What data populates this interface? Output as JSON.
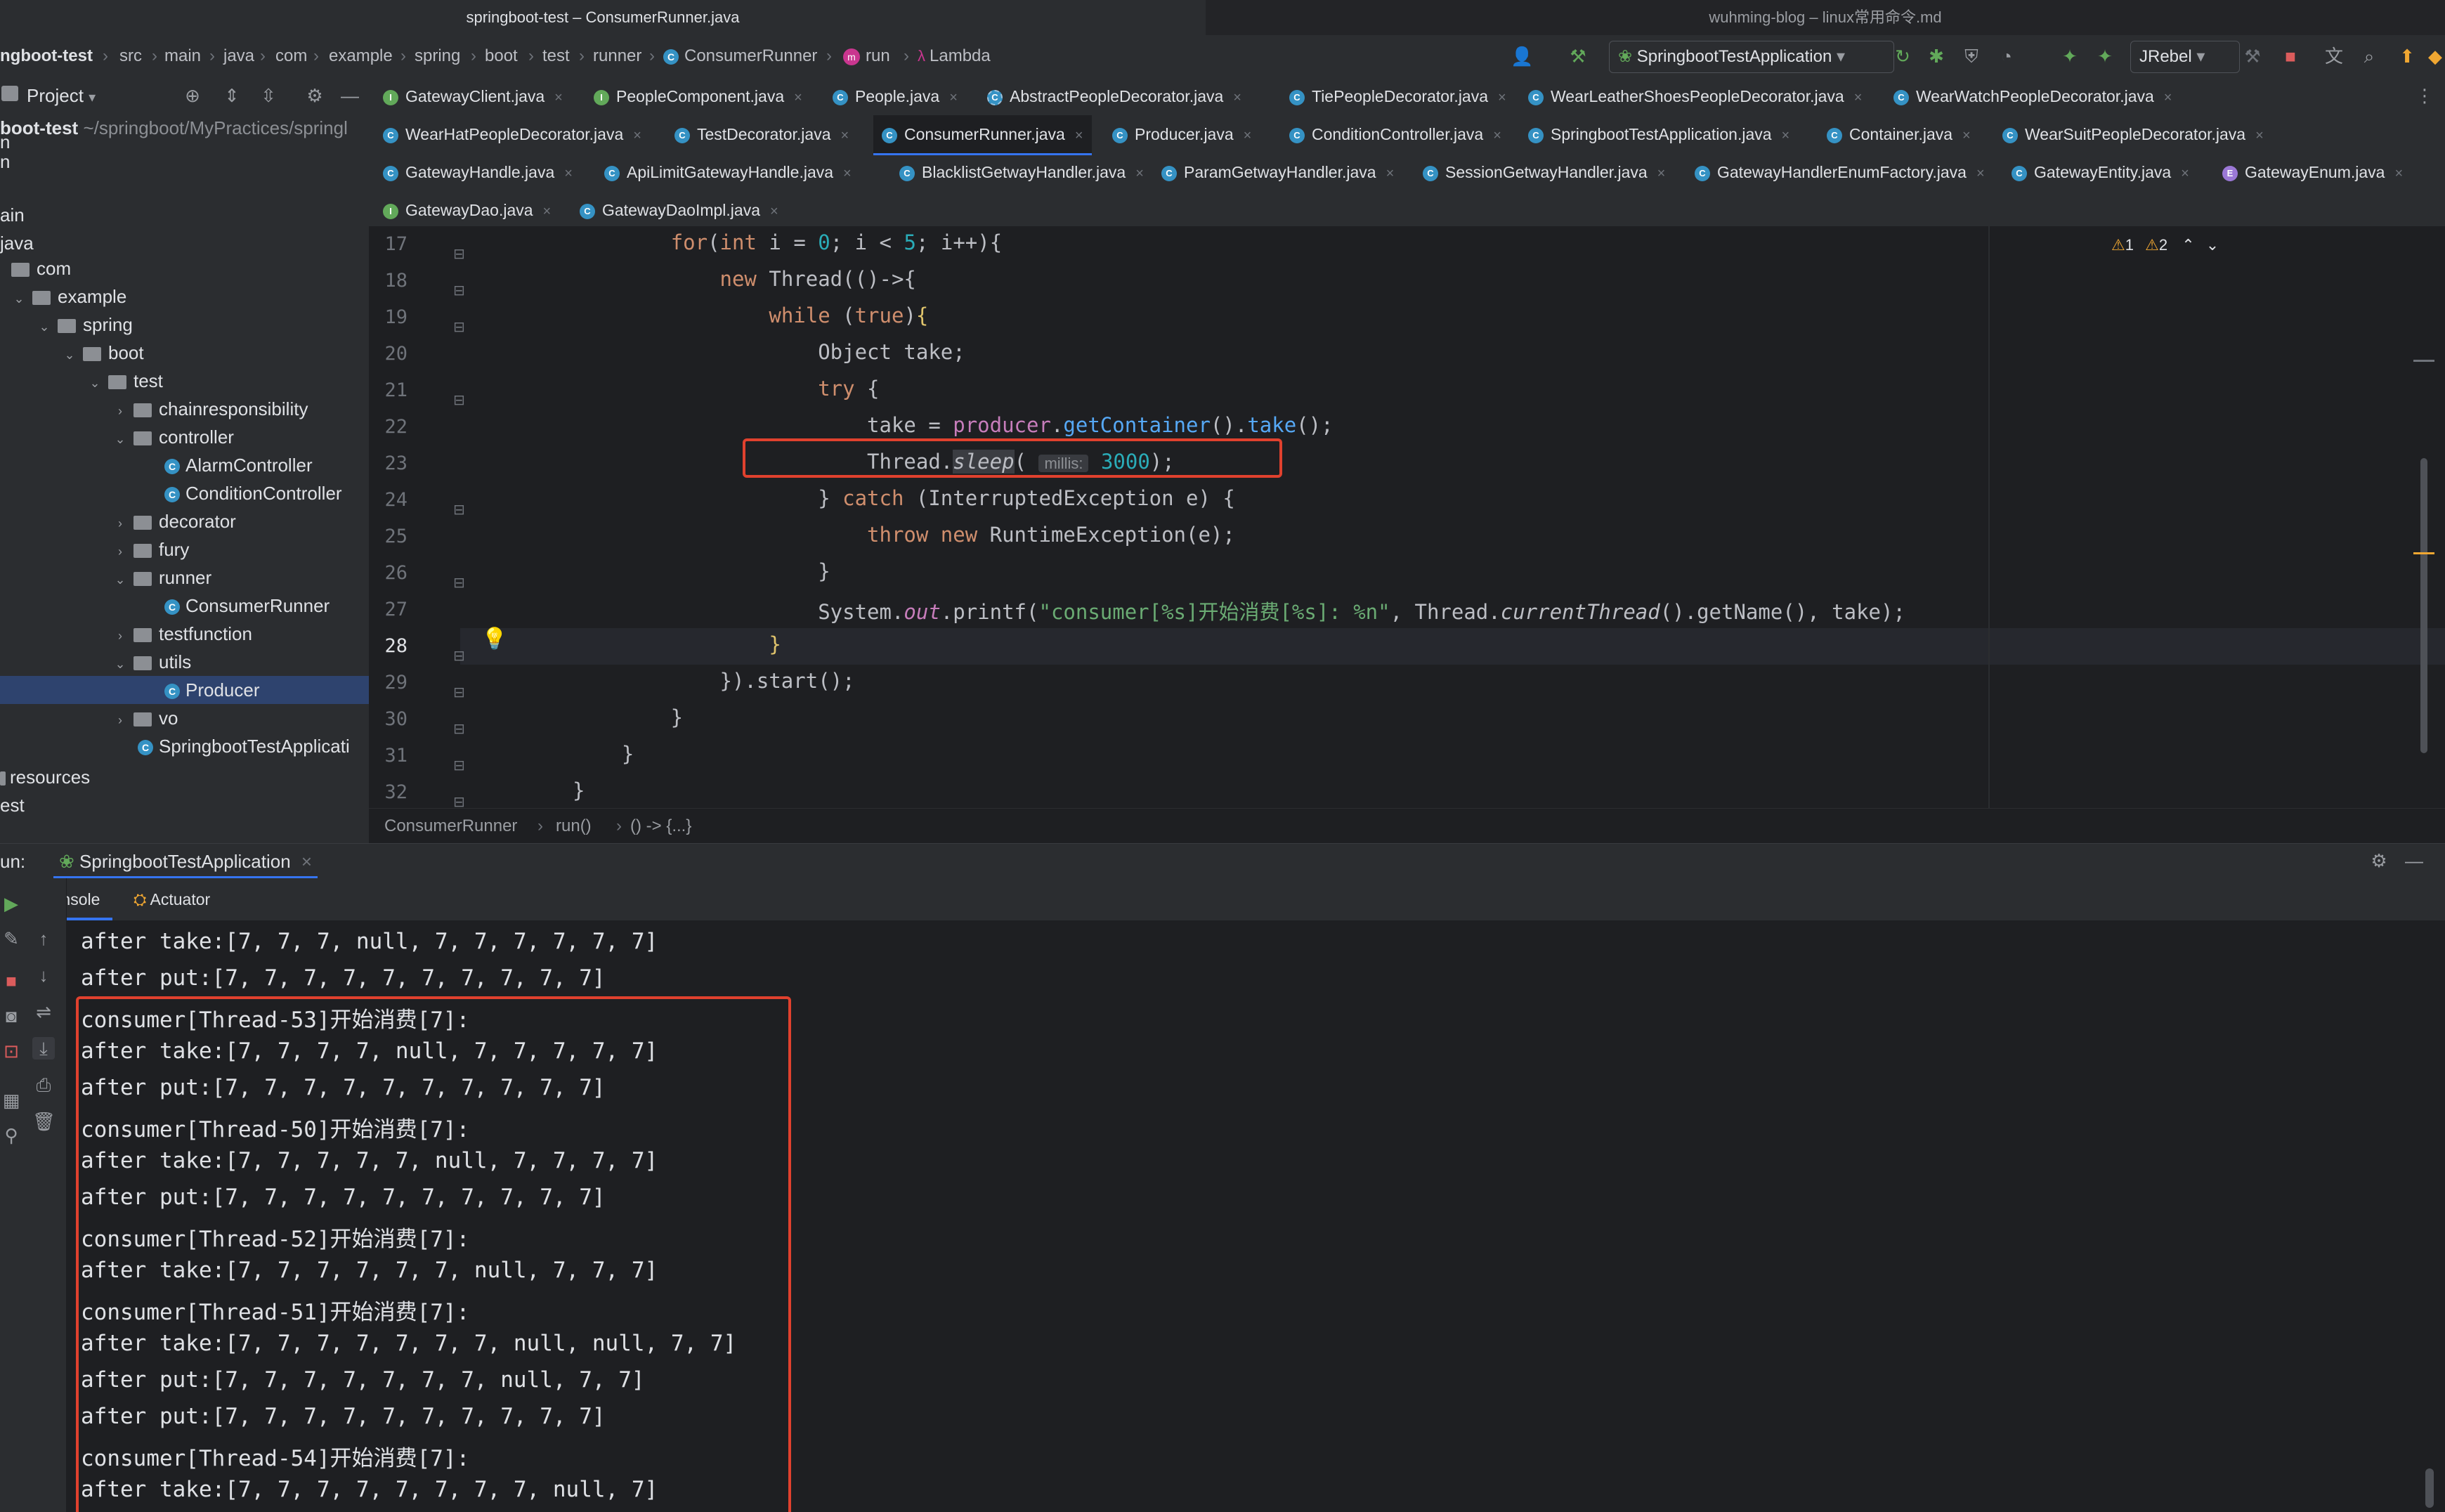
{
  "window": {
    "title_left": "springboot-test – ConsumerRunner.java",
    "title_right": "wuhming-blog – linux常用命令.md"
  },
  "nav": {
    "crumbs": [
      "ngboot-test",
      "src",
      "main",
      "java",
      "com",
      "example",
      "spring",
      "boot",
      "test",
      "runner",
      "ConsumerRunner",
      "run",
      "Lambda"
    ],
    "run_config": "SpringbootTestApplication",
    "jrebel": "JRebel"
  },
  "project": {
    "header": "Project",
    "root_label": "boot-test",
    "root_path": "~/springboot/MyPractices/springl",
    "items": [
      {
        "label": "n",
        "depth": 0
      },
      {
        "label": "n",
        "depth": 0
      },
      {
        "label": "",
        "depth": 0
      },
      {
        "label": "ain",
        "depth": 0
      },
      {
        "label": "java",
        "depth": 0
      },
      {
        "label": "com",
        "depth": 1
      },
      {
        "label": "example",
        "depth": 1
      },
      {
        "label": "spring",
        "depth": 2
      },
      {
        "label": "boot",
        "depth": 3
      },
      {
        "label": "test",
        "depth": 4
      },
      {
        "label": "chainresponsibility",
        "depth": 5
      },
      {
        "label": "controller",
        "depth": 5
      },
      {
        "label": "AlarmController",
        "depth": 6
      },
      {
        "label": "ConditionController",
        "depth": 6
      },
      {
        "label": "decorator",
        "depth": 5
      },
      {
        "label": "fury",
        "depth": 5
      },
      {
        "label": "runner",
        "depth": 5
      },
      {
        "label": "ConsumerRunner",
        "depth": 6
      },
      {
        "label": "testfunction",
        "depth": 5
      },
      {
        "label": "utils",
        "depth": 5
      },
      {
        "label": "Producer",
        "depth": 6
      },
      {
        "label": "vo",
        "depth": 5
      },
      {
        "label": "SpringbootTestApplicati",
        "depth": 5
      },
      {
        "label": "resources",
        "depth": 0
      },
      {
        "label": "est",
        "depth": 0
      }
    ]
  },
  "tabs": {
    "row1": [
      "GatewayClient.java",
      "PeopleComponent.java",
      "People.java",
      "AbstractPeopleDecorator.java",
      "TiePeopleDecorator.java",
      "WearLeatherShoesPeopleDecorator.java",
      "WearWatchPeopleDecorator.java"
    ],
    "row2": [
      "WearHatPeopleDecorator.java",
      "TestDecorator.java",
      "ConsumerRunner.java",
      "Producer.java",
      "ConditionController.java",
      "SpringbootTestApplication.java",
      "Container.java",
      "WearSuitPeopleDecorator.java"
    ],
    "row3": [
      "GatewayHandle.java",
      "ApiLimitGatewayHandle.java",
      "BlacklistGetwayHandler.java",
      "ParamGetwayHandler.java",
      "SessionGetwayHandler.java",
      "GatewayHandlerEnumFactory.java",
      "GatewayEntity.java",
      "GatewayEnum.java"
    ],
    "row4": [
      "GatewayDao.java",
      "GatewayDaoImpl.java"
    ]
  },
  "editor": {
    "line_numbers": [
      "17",
      "18",
      "19",
      "20",
      "21",
      "22",
      "23",
      "24",
      "25",
      "26",
      "27",
      "28",
      "29",
      "30",
      "31",
      "32"
    ],
    "current_line": "28",
    "warnings": "1",
    "weak_warnings": "2",
    "param_hint": "millis:",
    "breadcrumb": [
      "ConsumerRunner",
      "run()",
      "() -> {...}"
    ]
  },
  "run": {
    "label": "un:",
    "config_tab": "SpringbootTestApplication",
    "tabs": [
      "Console",
      "Actuator"
    ],
    "console_lines": [
      "after take:[7, 7, 7, null, 7, 7, 7, 7, 7, 7]",
      "after put:[7, 7, 7, 7, 7, 7, 7, 7, 7, 7]",
      "consumer[Thread-53]开始消费[7]:",
      "after take:[7, 7, 7, 7, null, 7, 7, 7, 7, 7]",
      "after put:[7, 7, 7, 7, 7, 7, 7, 7, 7, 7]",
      "consumer[Thread-50]开始消费[7]:",
      "after take:[7, 7, 7, 7, 7, null, 7, 7, 7, 7]",
      "after put:[7, 7, 7, 7, 7, 7, 7, 7, 7, 7]",
      "consumer[Thread-52]开始消费[7]:",
      "after take:[7, 7, 7, 7, 7, 7, null, 7, 7, 7]",
      "consumer[Thread-51]开始消费[7]:",
      "after take:[7, 7, 7, 7, 7, 7, 7, null, null, 7, 7]",
      "after put:[7, 7, 7, 7, 7, 7, 7, null, 7, 7]",
      "after put:[7, 7, 7, 7, 7, 7, 7, 7, 7, 7]",
      "consumer[Thread-54]开始消费[7]:",
      "after take:[7, 7, 7, 7, 7, 7, 7, 7, null, 7]"
    ]
  },
  "colors": {
    "accent": "#3574f0",
    "highlight_box": "#e0412e",
    "selection": "#2e436e"
  }
}
